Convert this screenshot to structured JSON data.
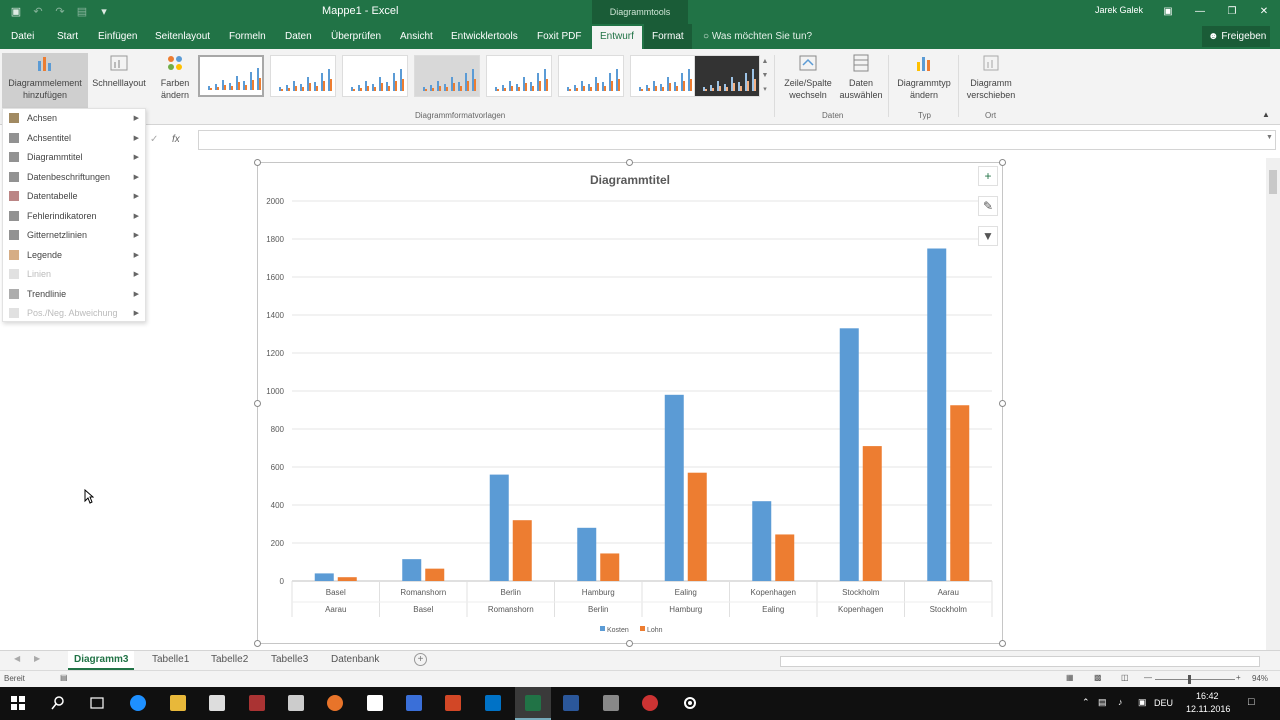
{
  "titlebar": {
    "title": "Mappe1 - Excel",
    "context_group": "Diagrammtools",
    "user": "Jarek Galek"
  },
  "tabs": [
    "Datei",
    "Start",
    "Einfügen",
    "Seitenlayout",
    "Formeln",
    "Daten",
    "Überprüfen",
    "Ansicht",
    "Entwicklertools",
    "Foxit PDF",
    "Entwurf",
    "Format"
  ],
  "active_tab": "Entwurf",
  "tell_me": "Was möchten Sie tun?",
  "share": "Freigeben",
  "ribbon": {
    "add_element": "Diagrammelement hinzufügen",
    "quick_layout": "Schnelllayout",
    "change_colors": "Farben ändern",
    "styles_group": "Diagrammformatvorlagen",
    "switch_row_col": "Zeile/Spalte wechseln",
    "select_data": "Daten auswählen",
    "data_group": "Daten",
    "change_type": "Diagrammtyp ändern",
    "type_group": "Typ",
    "move_chart": "Diagramm verschieben",
    "location_group": "Ort"
  },
  "menu": [
    {
      "label": "Achsen",
      "enabled": true
    },
    {
      "label": "Achsentitel",
      "enabled": true
    },
    {
      "label": "Diagrammtitel",
      "enabled": true
    },
    {
      "label": "Datenbeschriftungen",
      "enabled": true
    },
    {
      "label": "Datentabelle",
      "enabled": true
    },
    {
      "label": "Fehlerindikatoren",
      "enabled": true
    },
    {
      "label": "Gitternetzlinien",
      "enabled": true
    },
    {
      "label": "Legende",
      "enabled": true
    },
    {
      "label": "Linien",
      "enabled": false
    },
    {
      "label": "Trendlinie",
      "enabled": true
    },
    {
      "label": "Pos./Neg. Abweichung",
      "enabled": false
    }
  ],
  "colors": {
    "accent": "#217346",
    "series1": "#5b9bd5",
    "series2": "#ed7d31"
  },
  "chart_data": {
    "type": "bar",
    "title": "Diagrammtitel",
    "categories": [
      [
        "Basel",
        "Aarau"
      ],
      [
        "Romanshorn",
        "Basel"
      ],
      [
        "Berlin",
        "Romanshorn"
      ],
      [
        "Hamburg",
        "Berlin"
      ],
      [
        "Ealing",
        "Hamburg"
      ],
      [
        "Kopenhagen",
        "Ealing"
      ],
      [
        "Stockholm",
        "Kopenhagen"
      ],
      [
        "Aarau",
        "Stockholm"
      ]
    ],
    "series": [
      {
        "name": "Kosten",
        "values": [
          40,
          115,
          560,
          280,
          980,
          420,
          1330,
          1750
        ]
      },
      {
        "name": "Lohn",
        "values": [
          20,
          65,
          320,
          145,
          570,
          245,
          710,
          925
        ]
      }
    ],
    "ylim": [
      0,
      2000
    ],
    "yticks": [
      0,
      200,
      400,
      600,
      800,
      1000,
      1200,
      1400,
      1600,
      1800,
      2000
    ],
    "grid": true,
    "legend": "bottom"
  },
  "sheet_tabs": [
    "Diagramm3",
    "Tabelle1",
    "Tabelle2",
    "Tabelle3",
    "Datenbank"
  ],
  "active_sheet": "Diagramm3",
  "status": {
    "ready": "Bereit",
    "zoom": "94%"
  },
  "taskbar": {
    "lang": "DEU",
    "time": "16:42",
    "date": "12.11.2016"
  }
}
